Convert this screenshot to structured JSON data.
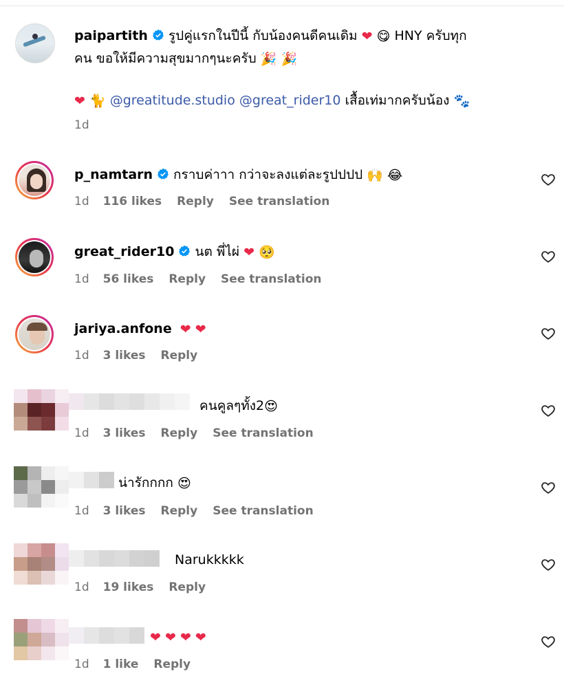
{
  "post": {
    "username": "paipartith",
    "line1": "รูปคู่แรกในปีนี้ กับน้องคนดีคนเดิม",
    "line1_tail": "HNY ครับทุก",
    "line2": "คน ขอให้มีความสุขมากๆนะครับ",
    "mention1": "@greatitude.studio",
    "mention2": "@great_rider10",
    "line3_tail": "เสื้อเท่มากครับน้อง",
    "time": "1d"
  },
  "comments": [
    {
      "username": "p_namtarn",
      "text": "กราบค่าาา กว่าจะลงแต่ละรูปปปป",
      "time": "1d",
      "likes": "116 likes",
      "reply": "Reply",
      "translate": "See translation"
    },
    {
      "username": "great_rider10",
      "text": "นต พี่ไผ่",
      "time": "1d",
      "likes": "56 likes",
      "reply": "Reply",
      "translate": "See translation"
    },
    {
      "username": "jariya.anfone",
      "text": "",
      "time": "1d",
      "likes": "3 likes",
      "reply": "Reply"
    },
    {
      "username": "",
      "text": "คนคูลๆทั้ง2",
      "time": "1d",
      "likes": "3 likes",
      "reply": "Reply",
      "translate": "See translation"
    },
    {
      "username": "",
      "text": "น่ารักกกก",
      "time": "1d",
      "likes": "3 likes",
      "reply": "Reply",
      "translate": "See translation"
    },
    {
      "username": "",
      "text": "Narukkkkk",
      "time": "1d",
      "likes": "19 likes",
      "reply": "Reply"
    },
    {
      "username": "",
      "text": "",
      "time": "1d",
      "likes": "1 like",
      "reply": "Reply"
    }
  ],
  "colors": {
    "verified": "#0095f6",
    "mention": "#3b5aa8",
    "meta": "#737373",
    "heart": "#e8294a"
  },
  "icons": [
    "verified-badge-icon",
    "heart-icon",
    "party-popper-icon",
    "paw-icon"
  ]
}
